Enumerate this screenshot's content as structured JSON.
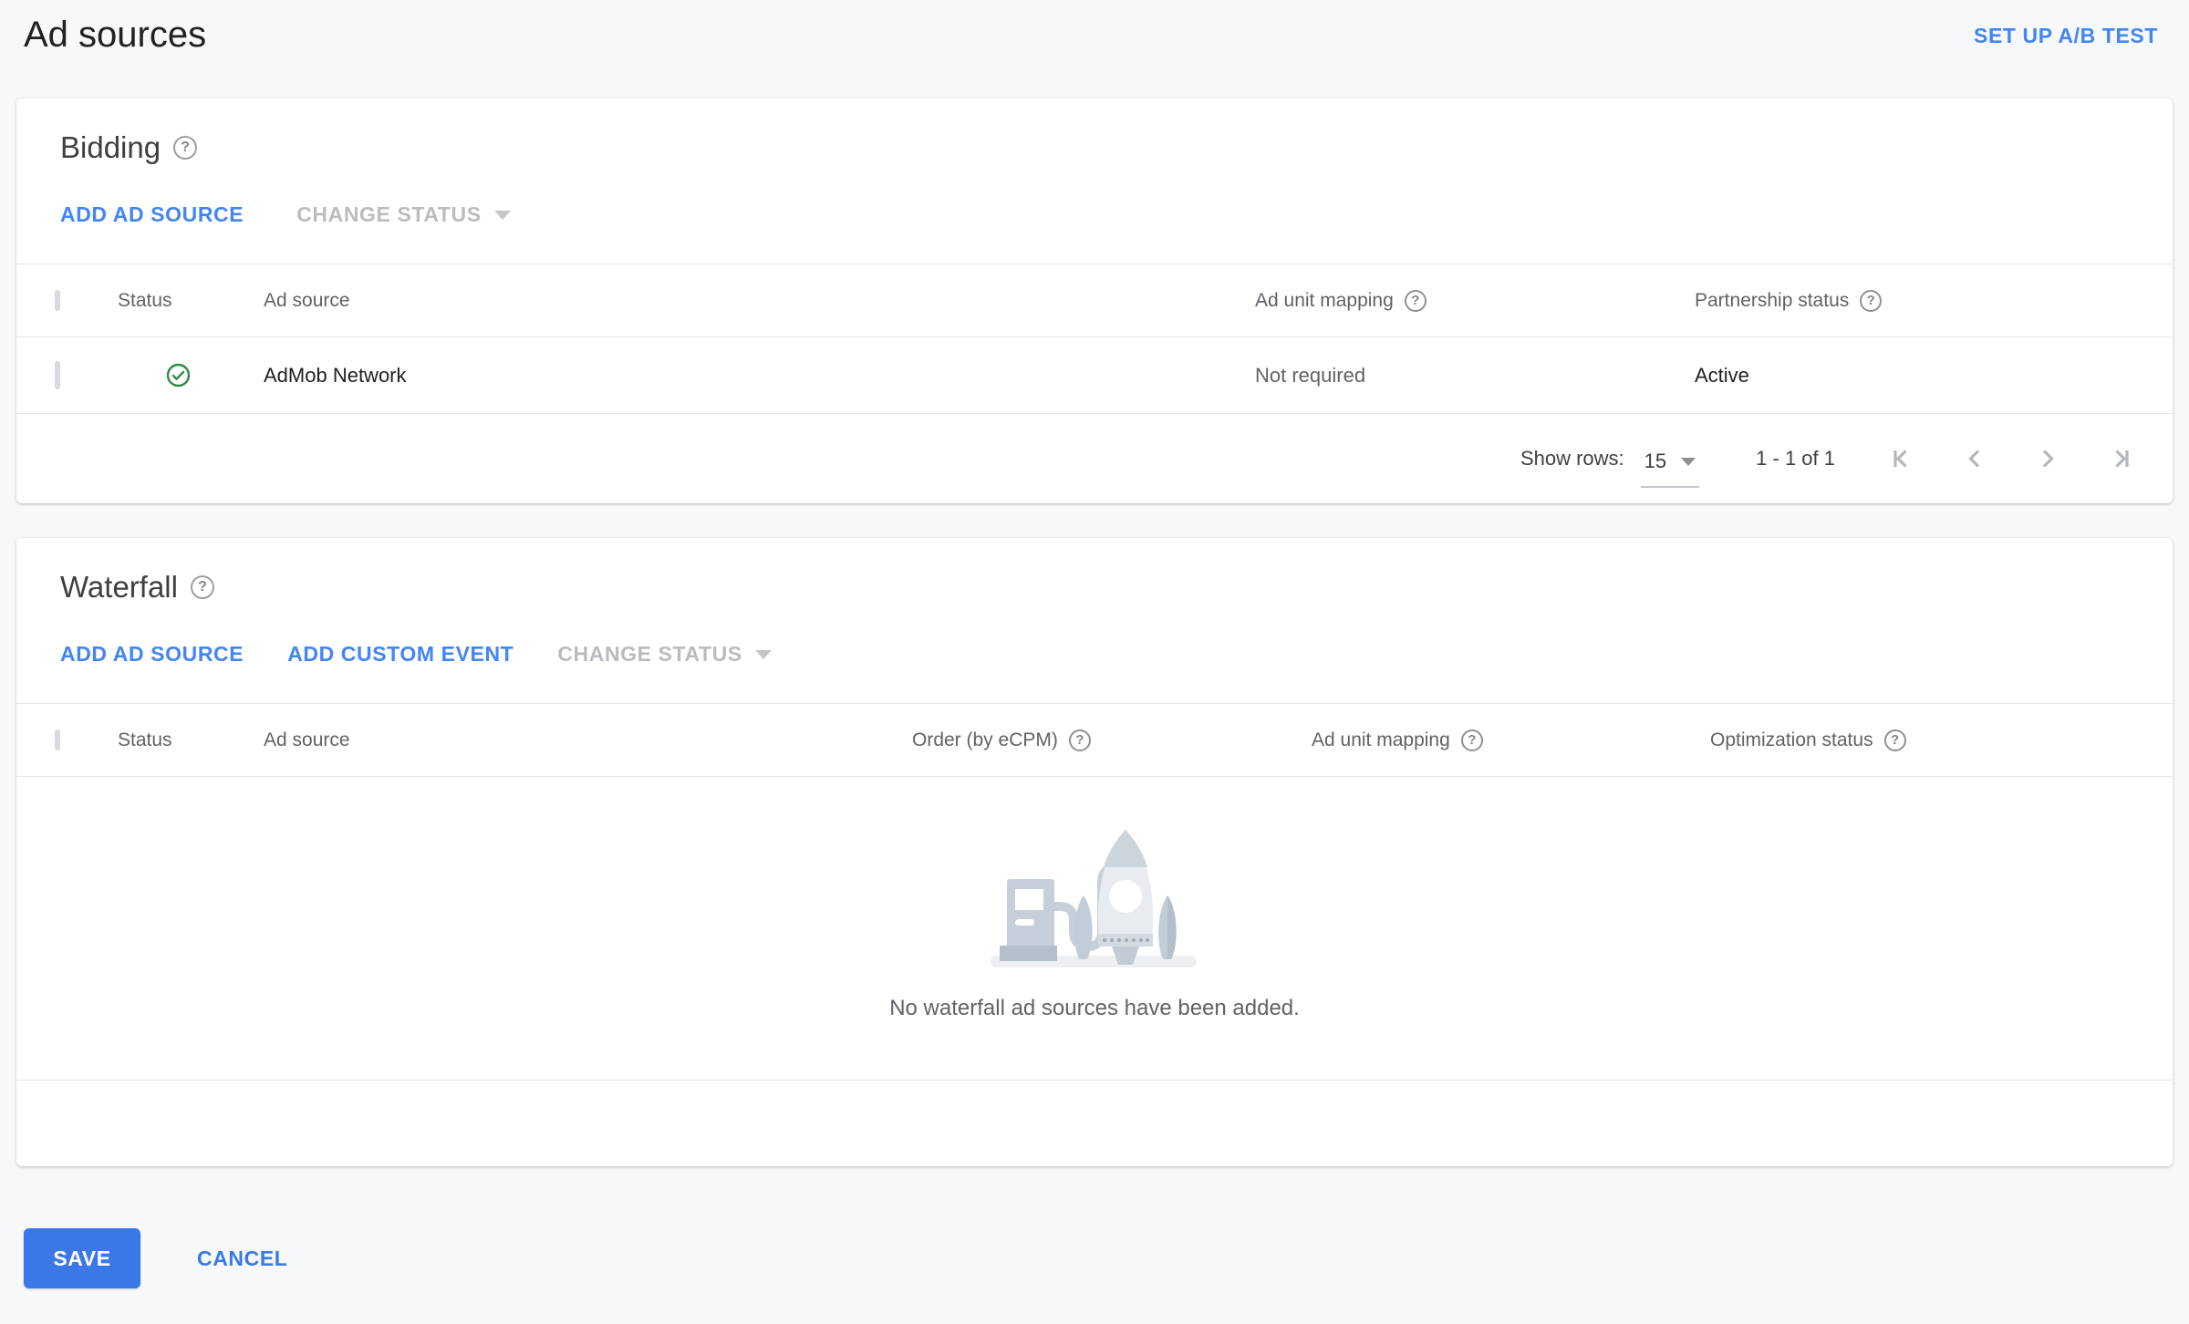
{
  "page": {
    "title": "Ad sources",
    "ab_test_link": "SET UP A/B TEST"
  },
  "bidding": {
    "title": "Bidding",
    "add_ad_source": "ADD AD SOURCE",
    "change_status": "CHANGE STATUS",
    "columns": {
      "status": "Status",
      "ad_source": "Ad source",
      "ad_unit_mapping": "Ad unit mapping",
      "partnership_status": "Partnership status"
    },
    "rows": [
      {
        "status": "active",
        "ad_source": "AdMob Network",
        "ad_unit_mapping": "Not required",
        "partnership_status": "Active"
      }
    ],
    "pagination": {
      "show_rows_label": "Show rows:",
      "rows_per_page": "15",
      "range": "1 - 1 of 1"
    }
  },
  "waterfall": {
    "title": "Waterfall",
    "add_ad_source": "ADD AD SOURCE",
    "add_custom_event": "ADD CUSTOM EVENT",
    "change_status": "CHANGE STATUS",
    "columns": {
      "status": "Status",
      "ad_source": "Ad source",
      "order": "Order (by eCPM)",
      "ad_unit_mapping": "Ad unit mapping",
      "optimization_status": "Optimization status"
    },
    "empty_message": "No waterfall ad sources have been added."
  },
  "actions": {
    "save": "SAVE",
    "cancel": "CANCEL"
  },
  "icons": {
    "help": "help-circle-question-icon",
    "row_status": "check-circle-icon",
    "pager": [
      "first-page-icon",
      "previous-page-icon",
      "next-page-icon",
      "last-page-icon"
    ]
  },
  "colors": {
    "accent_blue": "#4285f4",
    "save_button_blue": "#3b78e7",
    "active_green": "#2e8b43",
    "disabled_gray": "#b9bcc0",
    "header_gray": "#5f6368",
    "page_background": "#f7f8f9"
  }
}
